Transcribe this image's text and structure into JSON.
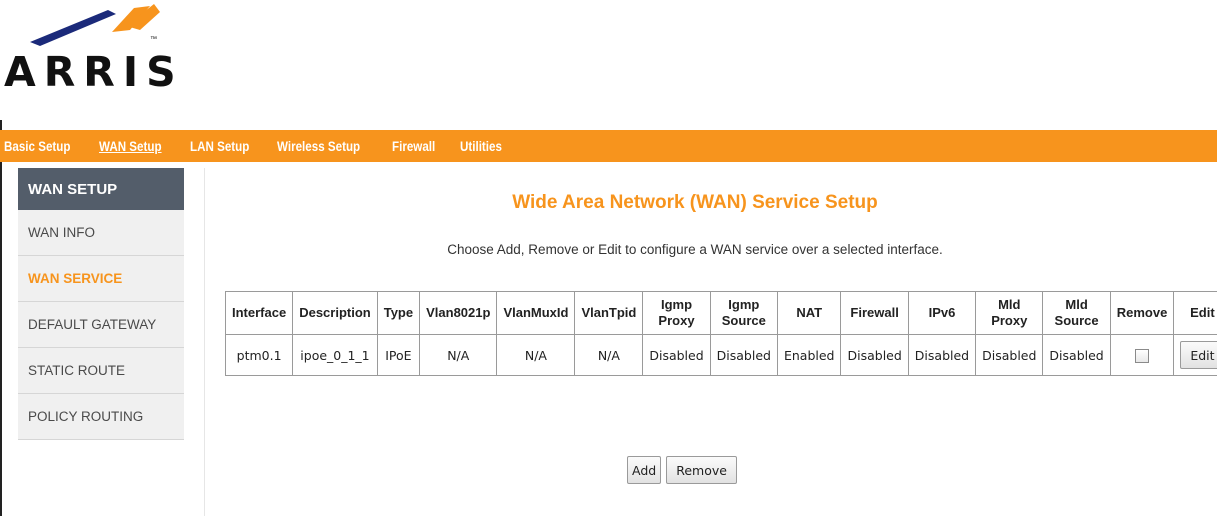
{
  "brand": {
    "logo_text": "ARRIS",
    "tm": "™",
    "accent_color": "#f7941d",
    "sidebar_head_color": "#535d6a"
  },
  "topnav": {
    "items": [
      {
        "label": "Basic Setup"
      },
      {
        "label": "WAN Setup",
        "active": true
      },
      {
        "label": "LAN Setup"
      },
      {
        "label": "Wireless Setup"
      },
      {
        "label": "Firewall"
      },
      {
        "label": "Utilities"
      }
    ]
  },
  "sidebar": {
    "heading": "WAN SETUP",
    "items": [
      {
        "label": "WAN INFO"
      },
      {
        "label": "WAN SERVICE",
        "active": true
      },
      {
        "label": "DEFAULT GATEWAY"
      },
      {
        "label": "STATIC ROUTE"
      },
      {
        "label": "POLICY ROUTING"
      }
    ]
  },
  "main": {
    "title": "Wide Area Network (WAN) Service Setup",
    "description": "Choose Add, Remove or Edit to configure a WAN service over a selected interface.",
    "table": {
      "headers": [
        "Interface",
        "Description",
        "Type",
        "Vlan8021p",
        "VlanMuxId",
        "VlanTpid",
        "Igmp Proxy",
        "Igmp Source",
        "NAT",
        "Firewall",
        "IPv6",
        "Mld Proxy",
        "Mld Source",
        "Remove",
        "Edit"
      ],
      "rows": [
        {
          "interface": "ptm0.1",
          "description": "ipoe_0_1_1",
          "type": "IPoE",
          "vlan8021p": "N/A",
          "vlanmuxid": "N/A",
          "vlantpid": "N/A",
          "igmp_proxy": "Disabled",
          "igmp_source": "Disabled",
          "nat": "Enabled",
          "firewall": "Disabled",
          "ipv6": "Disabled",
          "mld_proxy": "Disabled",
          "mld_source": "Disabled",
          "remove_checked": false,
          "edit_label": "Edit"
        }
      ]
    },
    "add_label": "Add",
    "remove_label": "Remove"
  }
}
